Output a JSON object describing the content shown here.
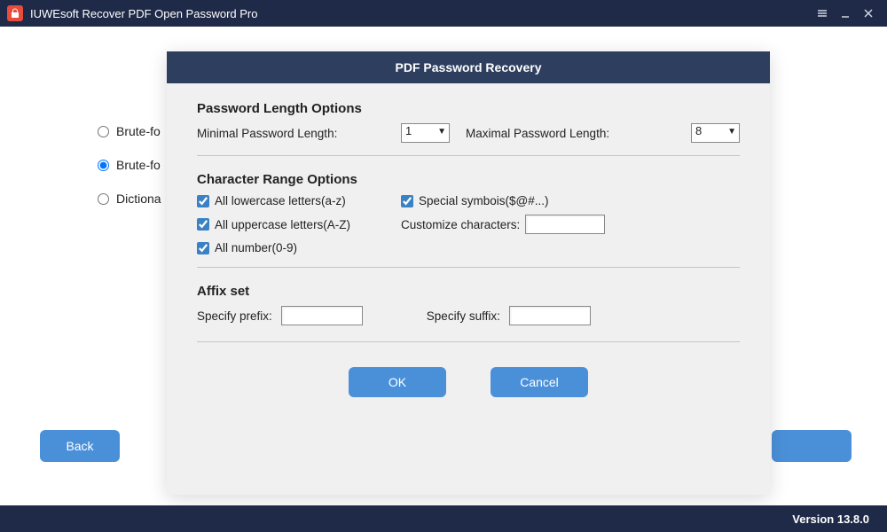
{
  "titlebar": {
    "app_name": "IUWEsoft Recover PDF Open Password Pro"
  },
  "main": {
    "radios": {
      "r1": "Brute-fo",
      "r2": "Brute-fo",
      "r3": "Dictiona"
    },
    "back_label": "Back"
  },
  "dialog": {
    "title": "PDF Password Recovery",
    "section_length": "Password Length Options",
    "min_label": "Minimal Password Length:",
    "min_value": "1",
    "max_label": "Maximal Password Length:",
    "max_value": "8",
    "section_char": "Character Range Options",
    "chk_lower": "All lowercase letters(a-z)",
    "chk_upper": "All uppercase letters(A-Z)",
    "chk_num": "All number(0-9)",
    "chk_special": "Special symbois($@#...)",
    "customize_label": "Customize characters:",
    "customize_value": "",
    "section_affix": "Affix set",
    "prefix_label": "Specify prefix:",
    "prefix_value": "",
    "suffix_label": "Specify suffix:",
    "suffix_value": "",
    "ok_label": "OK",
    "cancel_label": "Cancel"
  },
  "footer": {
    "version": "Version 13.8.0"
  }
}
